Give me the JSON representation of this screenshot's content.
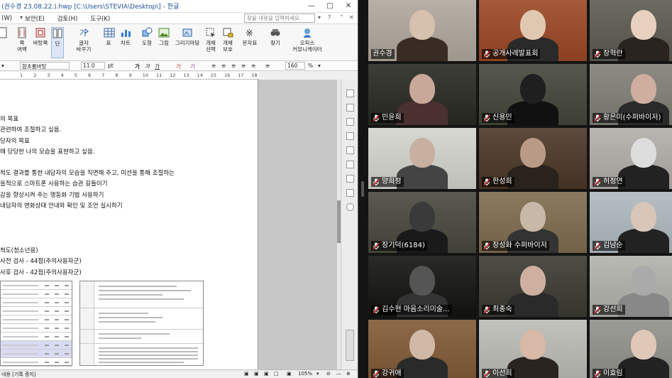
{
  "hwp": {
    "title": "(권수경 23.08.22.).hwp [C:\\Users\\STEVIA\\Desktop\\] - 한글",
    "menu": [
      "(W)",
      "보안(E)",
      "검토(H)",
      "도구(K)"
    ],
    "search_placeholder": "찾을 내용을 입력하세요.",
    "ribbon": [
      {
        "label": "쪽\n여백",
        "icon": "page-margin-icon"
      },
      {
        "label": "바탕쪽",
        "icon": "master-page-icon"
      },
      {
        "label": "단",
        "icon": "columns-icon"
      },
      {
        "label": "글자\n바꾸기",
        "icon": "char-replace-icon"
      },
      {
        "label": "표",
        "icon": "table-icon"
      },
      {
        "label": "차트",
        "icon": "chart-icon"
      },
      {
        "label": "도형",
        "icon": "shape-icon"
      },
      {
        "label": "그림",
        "icon": "picture-icon"
      },
      {
        "label": "그리기마당",
        "icon": "clipart-icon"
      },
      {
        "label": "개체\n선택",
        "icon": "object-select-icon"
      },
      {
        "label": "개체\n보호",
        "icon": "object-protect-icon"
      },
      {
        "label": "문자표",
        "icon": "symbol-icon"
      },
      {
        "label": "찾기",
        "icon": "find-icon"
      },
      {
        "label": "오피스\n커뮤니케이터",
        "icon": "office-communicator-icon"
      }
    ],
    "format": {
      "font": "함초롬바탕",
      "size": "11.0",
      "unit": "pt",
      "zoom_line": "160",
      "percent": "%"
    },
    "ruler": [
      "1",
      "2",
      "3",
      "4",
      "5",
      "6",
      "7",
      "8",
      "9",
      "10",
      "11",
      "12",
      "13",
      "14",
      "15",
      "16",
      "17",
      "18"
    ],
    "doc_lines": [
      "의 목표",
      "관련하여 조절하고 싶음.",
      "당자의 목표",
      "때 당당한 나의 모습을 표현하고 싶음.",
      "척도 결과를 통한 내담자의 모습을 직면해 주고, 미션을 통해 조절하는",
      "을적으로 스마트폰 사용하는 습관 길들이기",
      "감을 향상시켜 주는 행동화 기법 사용하기",
      "내담자의 변화상태 안내와 확인 및 조언 실시하기",
      "척도(청소년용)",
      "사전 검사 - 44점(주의사용자군)",
      "사후 검사 - 42점(주의사용자군)"
    ],
    "status": {
      "left": "내용 [기록 중지]",
      "zoom": "105%"
    }
  },
  "zoom": {
    "participants": [
      {
        "name": "권수경",
        "muted": false,
        "active": true
      },
      {
        "name": "공개사례발표회",
        "muted": true
      },
      {
        "name": "장혁란",
        "muted": true
      },
      {
        "name": "민윤희",
        "muted": true
      },
      {
        "name": "신용민",
        "muted": true
      },
      {
        "name": "황은미(수퍼바이저)",
        "muted": true
      },
      {
        "name": "양희평",
        "muted": true
      },
      {
        "name": "한성희",
        "muted": true
      },
      {
        "name": "허정연",
        "muted": true
      },
      {
        "name": "장기덕(6184)",
        "muted": true
      },
      {
        "name": "장성화 수퍼바이저",
        "muted": true
      },
      {
        "name": "김남순",
        "muted": true
      },
      {
        "name": "김수현 마음소리미술...",
        "muted": true
      },
      {
        "name": "최종숙",
        "muted": true
      },
      {
        "name": "강선희",
        "muted": true
      },
      {
        "name": "강귀애",
        "muted": true
      },
      {
        "name": "이선희",
        "muted": true
      },
      {
        "name": "이효림",
        "muted": true
      }
    ]
  }
}
